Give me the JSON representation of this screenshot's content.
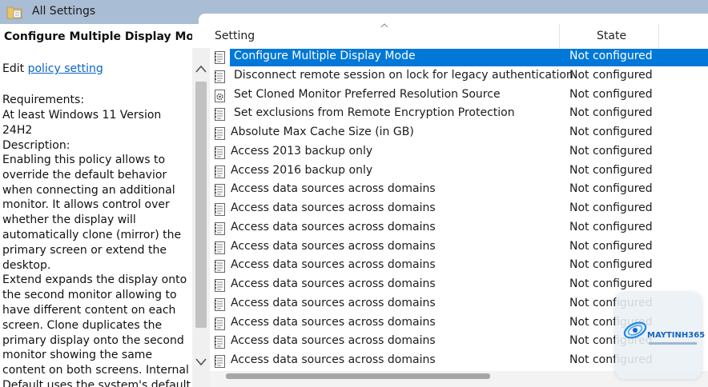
{
  "window": {
    "title": "All Settings",
    "folder_icon": "folder-settings-icon"
  },
  "description_pane": {
    "heading": "Configure Multiple Display Mode",
    "edit_prefix": "Edit ",
    "edit_link": "policy setting ",
    "requirements_label": "Requirements:",
    "requirements_value": "At least Windows 11 Version 24H2",
    "description_label": "Description:",
    "description_lines": [
      "Enabling this policy allows to",
      "override the default behavior",
      "when connecting an additional",
      "monitor. It allows control over",
      "whether the display will",
      "automatically clone (mirror) the",
      "primary screen or extend the",
      "desktop.",
      "Extend expands the display onto",
      "the second monitor allowing to",
      "have different content on each",
      "screen. Clone duplicates the",
      "primary display onto the second",
      "monitor showing the same",
      "content on both screens. Internal",
      "Default uses the system's default"
    ]
  },
  "columns": {
    "setting": "Setting",
    "state": "State"
  },
  "rows": [
    {
      "name": "Configure Multiple Display Mode",
      "state": "Not configured",
      "selected": true,
      "icon": "policy-page-icon"
    },
    {
      "name": "Disconnect remote session on lock for legacy authentication",
      "state": "Not configured",
      "icon": "policy-page-icon"
    },
    {
      "name": "Set Cloned Monitor Preferred Resolution Source",
      "state": "Not configured",
      "icon": "policy-gear-icon"
    },
    {
      "name": "Set exclusions from Remote Encryption Protection",
      "state": "Not configured",
      "icon": "policy-page-icon"
    },
    {
      "name": "Absolute Max Cache Size (in GB)",
      "state": "Not configured",
      "icon": "policy-page-icon"
    },
    {
      "name": "Access 2013 backup only",
      "state": "Not configured",
      "icon": "policy-page-icon"
    },
    {
      "name": "Access 2016 backup only",
      "state": "Not configured",
      "icon": "policy-page-icon"
    },
    {
      "name": "Access data sources across domains",
      "state": "Not configured",
      "icon": "policy-page-icon"
    },
    {
      "name": "Access data sources across domains",
      "state": "Not configured",
      "icon": "policy-page-icon"
    },
    {
      "name": "Access data sources across domains",
      "state": "Not configured",
      "icon": "policy-page-icon"
    },
    {
      "name": "Access data sources across domains",
      "state": "Not configured",
      "icon": "policy-page-icon"
    },
    {
      "name": "Access data sources across domains",
      "state": "Not configured",
      "icon": "policy-page-icon"
    },
    {
      "name": "Access data sources across domains",
      "state": "Not configured",
      "icon": "policy-page-icon"
    },
    {
      "name": "Access data sources across domains",
      "state": "Not configured",
      "icon": "policy-page-icon"
    },
    {
      "name": "Access data sources across domains",
      "state": "Not configured",
      "icon": "policy-page-icon"
    },
    {
      "name": "Access data sources across domains",
      "state": "Not configured",
      "icon": "policy-page-icon"
    },
    {
      "name": "Access data sources across domains",
      "state": "Not configured",
      "icon": "policy-page-icon"
    }
  ],
  "watermark": {
    "brand": "MAYTINH365"
  },
  "colors": {
    "selection": "#0078d7",
    "link": "#0a64c8",
    "header_band": "#a9bdd5"
  }
}
